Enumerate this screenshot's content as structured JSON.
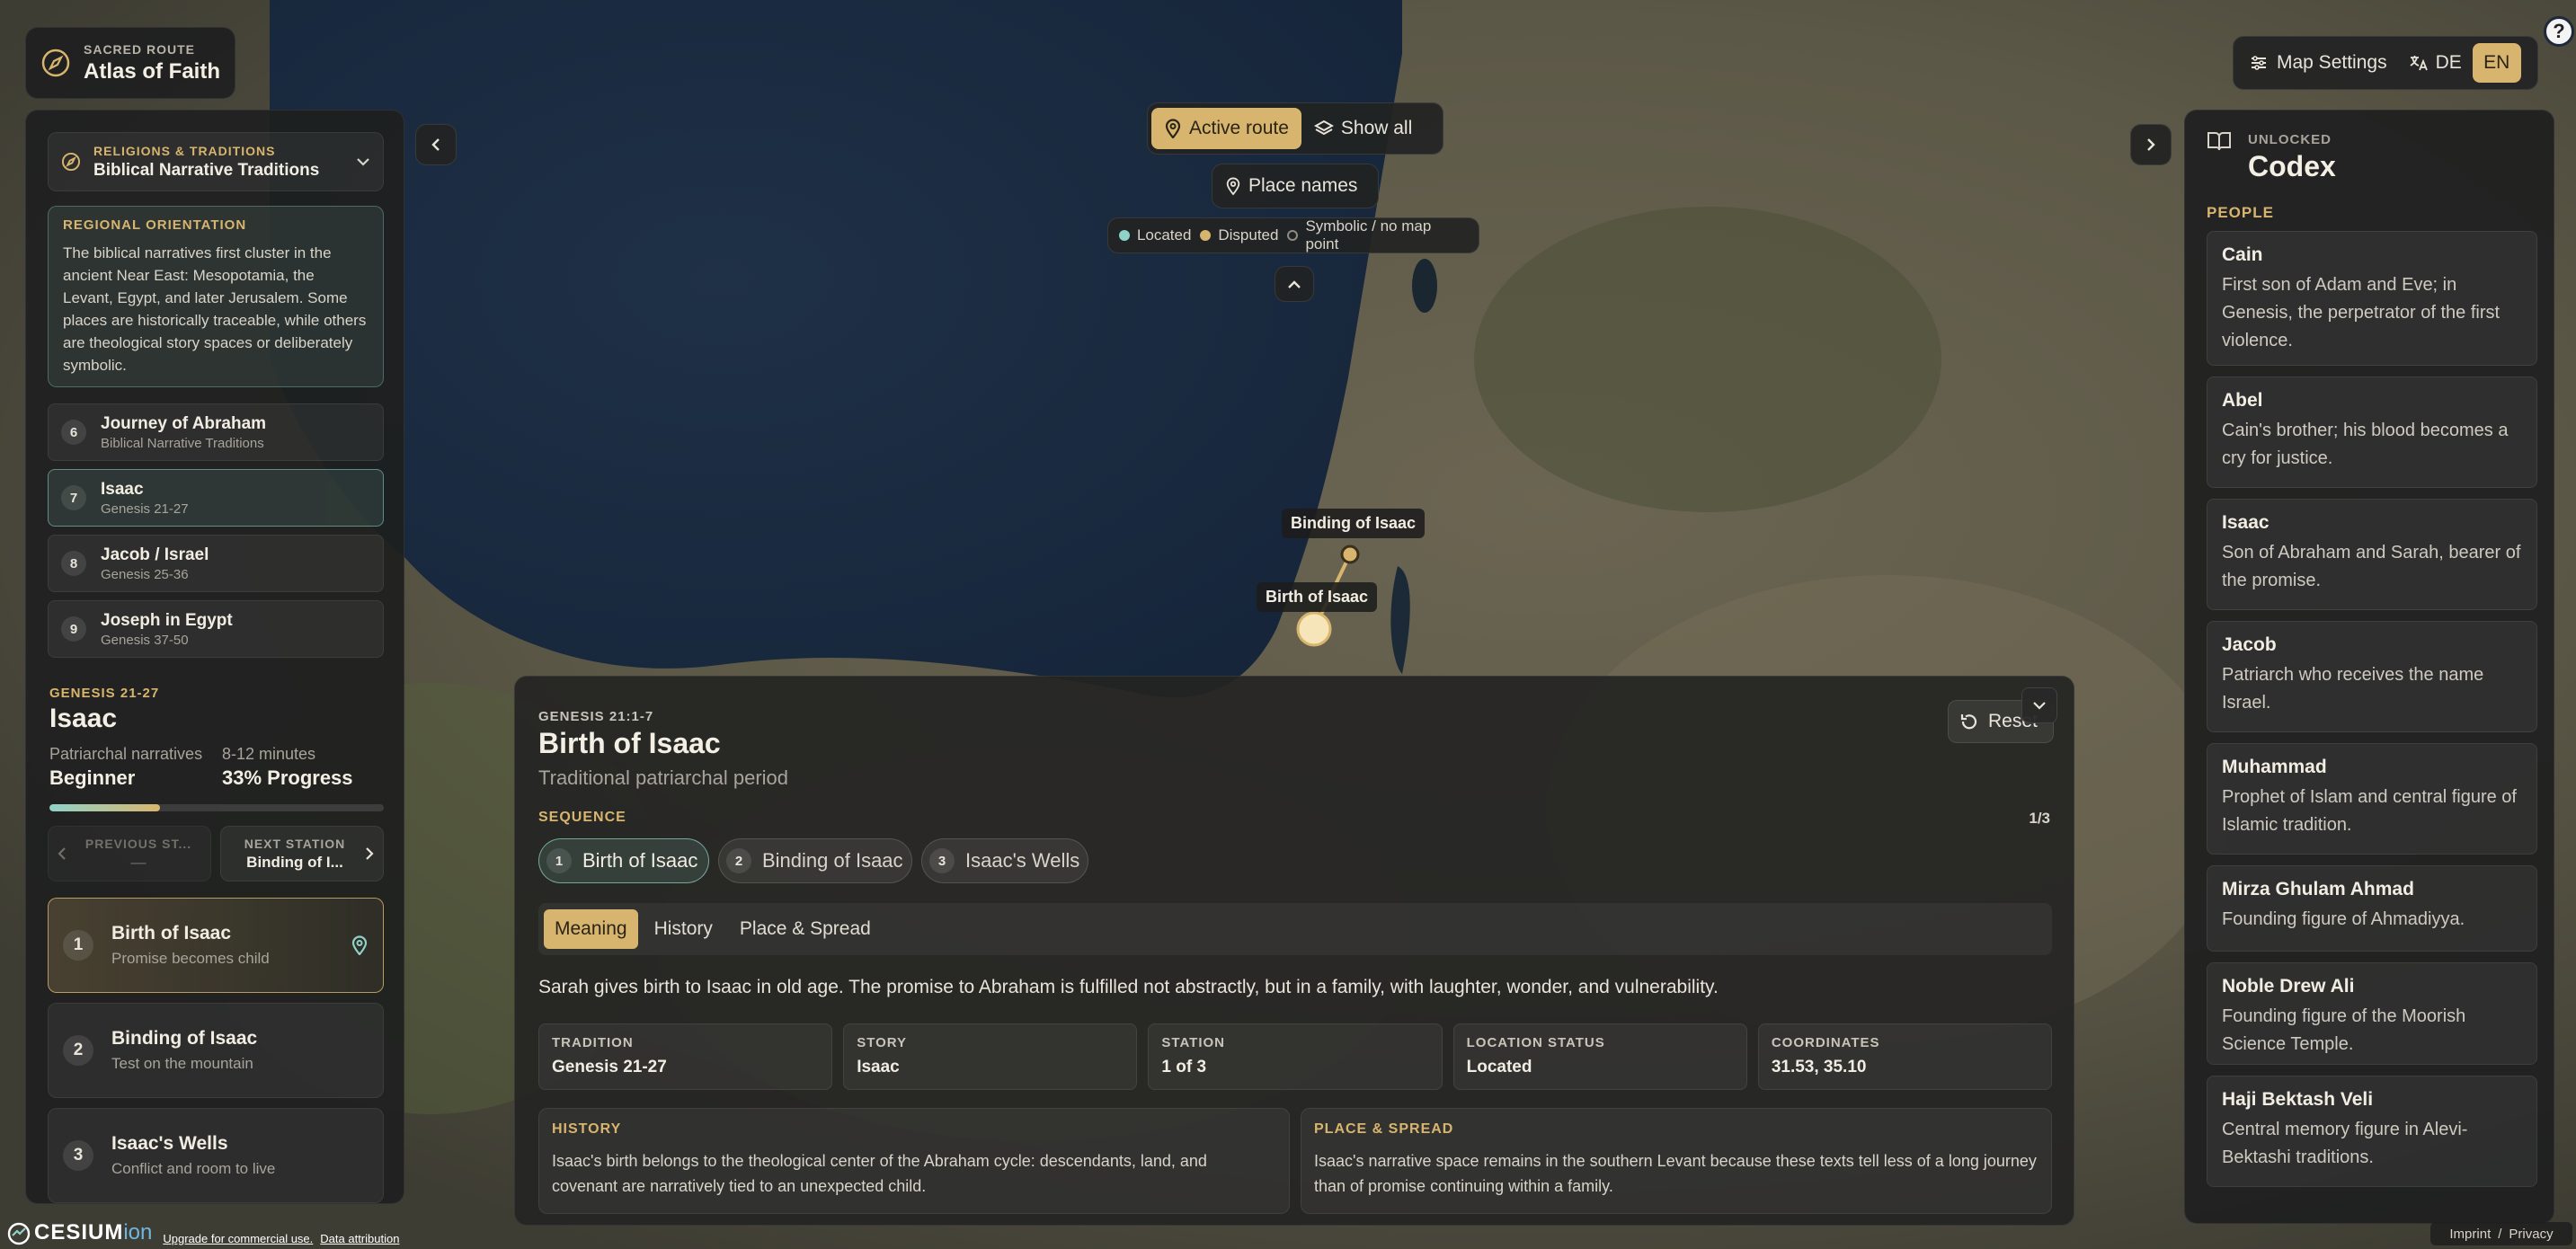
{
  "brand": {
    "kicker": "SACRED ROUTE",
    "title": "Atlas of Faith"
  },
  "top_controls": {
    "active_route": "Active route",
    "show_all": "Show all",
    "place_names": "Place names"
  },
  "legend": {
    "located": "Located",
    "disputed": "Disputed",
    "symbolic": "Symbolic / no map point"
  },
  "header_right": {
    "map_settings": "Map Settings",
    "lang_de": "DE",
    "lang_en": "EN"
  },
  "left": {
    "tradition_kicker": "RELIGIONS & TRADITIONS",
    "tradition_title": "Biblical Narrative Traditions",
    "orientation_title": "REGIONAL ORIENTATION",
    "orientation_text": "The biblical narratives first cluster in the ancient Near East: Mesopotamia, the Levant, Egypt, and later Jerusalem. Some places are historically traceable, while others are theological story spaces or deliberately symbolic.",
    "stories": [
      {
        "n": "6",
        "title": "Journey of Abraham",
        "sub": "Biblical Narrative Traditions"
      },
      {
        "n": "7",
        "title": "Isaac",
        "sub": "Genesis 21-27"
      },
      {
        "n": "8",
        "title": "Jacob / Israel",
        "sub": "Genesis 25-36"
      },
      {
        "n": "9",
        "title": "Joseph in Egypt",
        "sub": "Genesis 37-50"
      }
    ],
    "current_ref": "GENESIS 21-27",
    "current_title": "Isaac",
    "meta1_label": "Patriarchal narratives",
    "meta1_value": "Beginner",
    "meta2_label": "8-12 minutes",
    "meta2_value": "33% Progress",
    "progress": 0.33,
    "prev_label": "PREVIOUS ST...",
    "prev_value": "—",
    "next_label": "NEXT STATION",
    "next_value": "Binding of I...",
    "stations": [
      {
        "n": "1",
        "title": "Birth of Isaac",
        "sub": "Promise becomes child"
      },
      {
        "n": "2",
        "title": "Binding of Isaac",
        "sub": "Test on the mountain"
      },
      {
        "n": "3",
        "title": "Isaac's Wells",
        "sub": "Conflict and room to live"
      }
    ]
  },
  "map_labels": {
    "binding": "Binding of Isaac",
    "birth": "Birth of Isaac"
  },
  "detail": {
    "ref": "GENESIS 21:1-7",
    "title": "Birth of Isaac",
    "period": "Traditional patriarchal period",
    "reset": "Reset",
    "sequence_label": "SEQUENCE",
    "sequence_count": "1/3",
    "sequence": [
      {
        "n": "1",
        "label": "Birth of Isaac"
      },
      {
        "n": "2",
        "label": "Binding of Isaac"
      },
      {
        "n": "3",
        "label": "Isaac's Wells"
      }
    ],
    "tabs": [
      "Meaning",
      "History",
      "Place & Spread"
    ],
    "meaning": "Sarah gives birth to Isaac in old age. The promise to Abraham is fulfilled not abstractly, but in a family, with laughter, wonder, and vulnerability.",
    "facts": [
      {
        "label": "TRADITION",
        "value": "Genesis 21-27"
      },
      {
        "label": "STORY",
        "value": "Isaac"
      },
      {
        "label": "STATION",
        "value": "1 of 3"
      },
      {
        "label": "LOCATION STATUS",
        "value": "Located"
      },
      {
        "label": "COORDINATES",
        "value": "31.53, 35.10"
      }
    ],
    "history_title": "HISTORY",
    "history_text": "Isaac's birth belongs to the theological center of the Abraham cycle: descendants, land, and covenant are narratively tied to an unexpected child.",
    "spread_title": "PLACE & SPREAD",
    "spread_text": "Isaac's narrative space remains in the southern Levant because these texts tell less of a long journey than of promise continuing within a family."
  },
  "codex": {
    "kicker": "UNLOCKED",
    "title": "Codex",
    "section": "PEOPLE",
    "people": [
      {
        "name": "Cain",
        "desc": "First son of Adam and Eve; in Genesis, the perpetrator of the first violence."
      },
      {
        "name": "Abel",
        "desc": "Cain's brother; his blood becomes a cry for justice."
      },
      {
        "name": "Isaac",
        "desc": "Son of Abraham and Sarah, bearer of the promise."
      },
      {
        "name": "Jacob",
        "desc": "Patriarch who receives the name Israel."
      },
      {
        "name": "Muhammad",
        "desc": "Prophet of Islam and central figure of Islamic tradition."
      },
      {
        "name": "Mirza Ghulam Ahmad",
        "desc": "Founding figure of Ahmadiyya."
      },
      {
        "name": "Noble Drew Ali",
        "desc": "Founding figure of the Moorish Science Temple."
      },
      {
        "name": "Haji Bektash Veli",
        "desc": "Central memory figure in Alevi-Bektashi traditions."
      }
    ]
  },
  "footer": {
    "cesium": "CESIUM",
    "ion": "ion",
    "upgrade": "Upgrade for commercial use.",
    "attribution": "Data attribution",
    "imprint": "Imprint",
    "sep": "/",
    "privacy": "Privacy"
  },
  "colors": {
    "accent": "#d8b56e",
    "located": "#8fd3c8",
    "disputed": "#d8b56e",
    "panel": "#1f2020"
  }
}
